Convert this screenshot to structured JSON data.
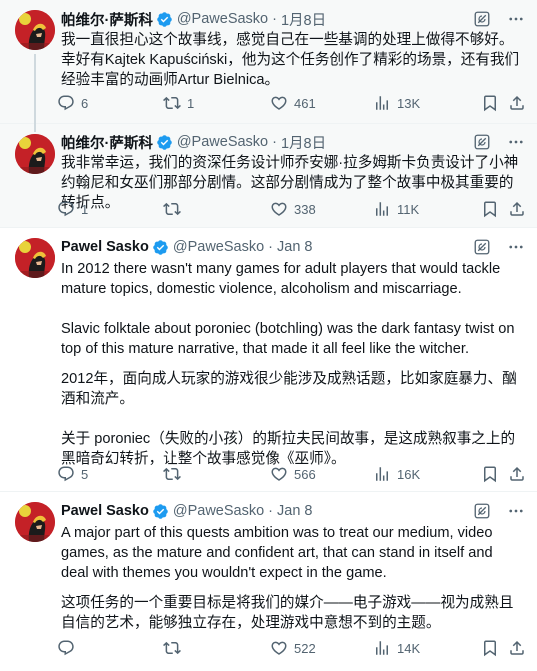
{
  "colors": {
    "accent": "#1d9bf0",
    "muted": "#536471",
    "verified": "#1d9bf0",
    "highlight_bg": "#f7f9f9"
  },
  "icons": [
    "grok-icon",
    "more-icon",
    "reply-icon",
    "retweet-icon",
    "like-icon",
    "views-icon",
    "bookmark-icon",
    "share-icon",
    "verified-badge-icon"
  ],
  "tweets": [
    {
      "name": "帕维尔·萨斯科",
      "handle": "@PaweSasko",
      "dot": "·",
      "time": "1月8日",
      "paragraphs": [
        "我一直很担心这个故事线，感觉自己在一些基调的处理上做得不够好。幸好有Kajtek Kapuściński，他为这个任务创作了精彩的场景，还有我们经验丰富的动画师Artur Bielnica。"
      ],
      "replies": "6",
      "retweets": "1",
      "likes": "461",
      "views": "13K"
    },
    {
      "name": "帕维尔·萨斯科",
      "handle": "@PaweSasko",
      "dot": "·",
      "time": "1月8日",
      "paragraphs": [
        "我非常幸运，我们的资深任务设计师乔安娜·拉多姆斯卡负责设计了小神约翰尼和女巫们那部分剧情。这部分剧情成为了整个故事中极其重要的转折点。"
      ],
      "replies": "1",
      "retweets": "",
      "likes": "338",
      "views": "11K"
    },
    {
      "name": "Pawel Sasko",
      "handle": "@PaweSasko",
      "dot": "·",
      "time": "Jan 8",
      "paragraphs": [
        "In 2012 there wasn't many games for adult players that would tackle mature topics, domestic violence, alcoholism and miscarriage.",
        "Slavic folktale about poroniec (botchling) was the dark fantasy twist on top of this mature narrative, that made it all feel like the witcher.",
        "2012年，面向成人玩家的游戏很少能涉及成熟话题，比如家庭暴力、酗酒和流产。",
        "关于 poroniec（失败的小孩）的斯拉夫民间故事，是这成熟叙事之上的黑暗奇幻转折，让整个故事感觉像《巫师》。"
      ],
      "replies": "5",
      "retweets": "",
      "likes": "566",
      "views": "16K"
    },
    {
      "name": "Pawel Sasko",
      "handle": "@PaweSasko",
      "dot": "·",
      "time": "Jan 8",
      "paragraphs": [
        "A major part of this quests ambition was to treat our medium, video games, as the mature and confident art, that can stand in itself and deal with themes you wouldn't expect in the game.",
        "这项任务的一个重要目标是将我们的媒介——电子游戏——视为成熟且自信的艺术，能够独立存在，处理游戏中意想不到的主题。"
      ],
      "replies": "",
      "retweets": "",
      "likes": "522",
      "views": "14K"
    }
  ]
}
